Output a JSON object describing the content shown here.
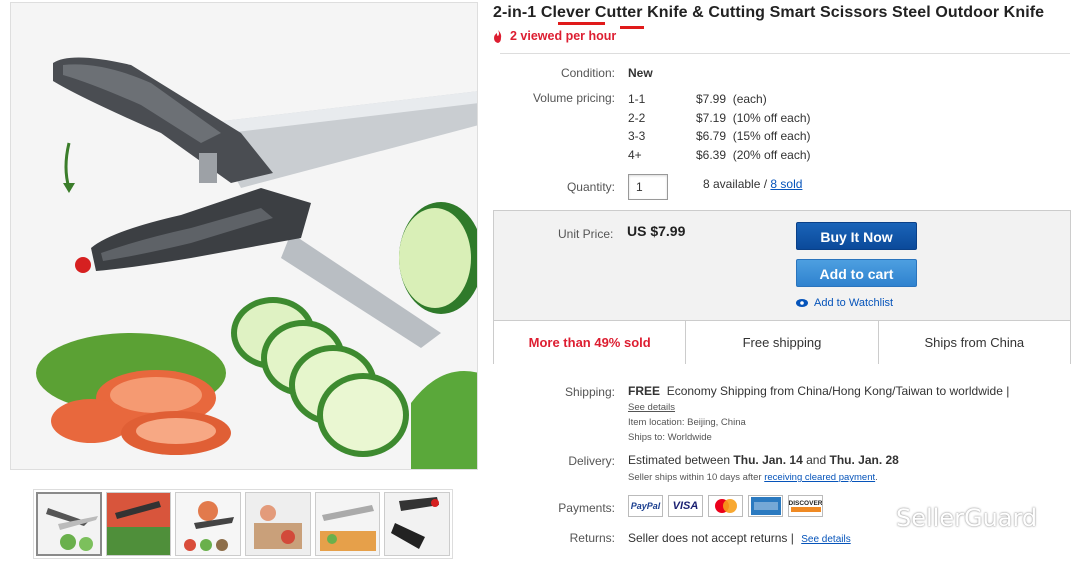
{
  "product": {
    "title": "2-in-1 Clever Cutter Knife & Cutting Smart Scissors Steel Outdoor Knife",
    "viewed": "2 viewed per hour"
  },
  "condition": {
    "label": "Condition:",
    "value": "New"
  },
  "volume_pricing": {
    "label": "Volume pricing:",
    "rows": [
      {
        "qty": "1-1",
        "price": "$7.99",
        "note": "(each)"
      },
      {
        "qty": "2-2",
        "price": "$7.19",
        "note": "(10% off each)"
      },
      {
        "qty": "3-3",
        "price": "$6.79",
        "note": "(15% off each)"
      },
      {
        "qty": "4+",
        "price": "$6.39",
        "note": "(20% off each)"
      }
    ]
  },
  "quantity": {
    "label": "Quantity:",
    "value": "1",
    "available": "8 available /",
    "sold_link": "8 sold"
  },
  "buybox": {
    "price_label": "Unit Price:",
    "price": "US $7.99",
    "buy_now": "Buy It Now",
    "add_to_cart": "Add to cart",
    "watchlist": "Add to Watchlist",
    "strip": [
      "More than 49% sold",
      "Free shipping",
      "Ships from China"
    ]
  },
  "shipping": {
    "label": "Shipping:",
    "free": "FREE",
    "text": "Economy Shipping from China/Hong Kong/Taiwan to worldwide |",
    "see_details": "See details",
    "item_location": "Item location:  Beijing, China",
    "ships_to": "Ships to:  Worldwide"
  },
  "delivery": {
    "label": "Delivery:",
    "prefix": "Estimated between",
    "date1": "Thu. Jan. 14",
    "and": "and",
    "date2": "Thu. Jan. 28",
    "note": "Seller ships within 10 days after",
    "note_link": "receiving cleared payment",
    "note_end": "."
  },
  "payments": {
    "label": "Payments:",
    "cards": [
      "PayPal",
      "VISA",
      "",
      "",
      "DISCOVER"
    ]
  },
  "returns": {
    "label": "Returns:",
    "text": "Seller does not accept returns |",
    "see_details": "See details"
  },
  "watermark": "SellerGuard",
  "colors": {
    "title_underline": "#e01a1a",
    "accent_red": "#dd1e31",
    "buy_now": "#0b4a9a",
    "add_to_cart": "#2f82cf",
    "link": "#0654ba"
  },
  "icons": [
    "fire-icon",
    "eye-icon",
    "wechat-icon",
    "down-arrow-icon"
  ]
}
